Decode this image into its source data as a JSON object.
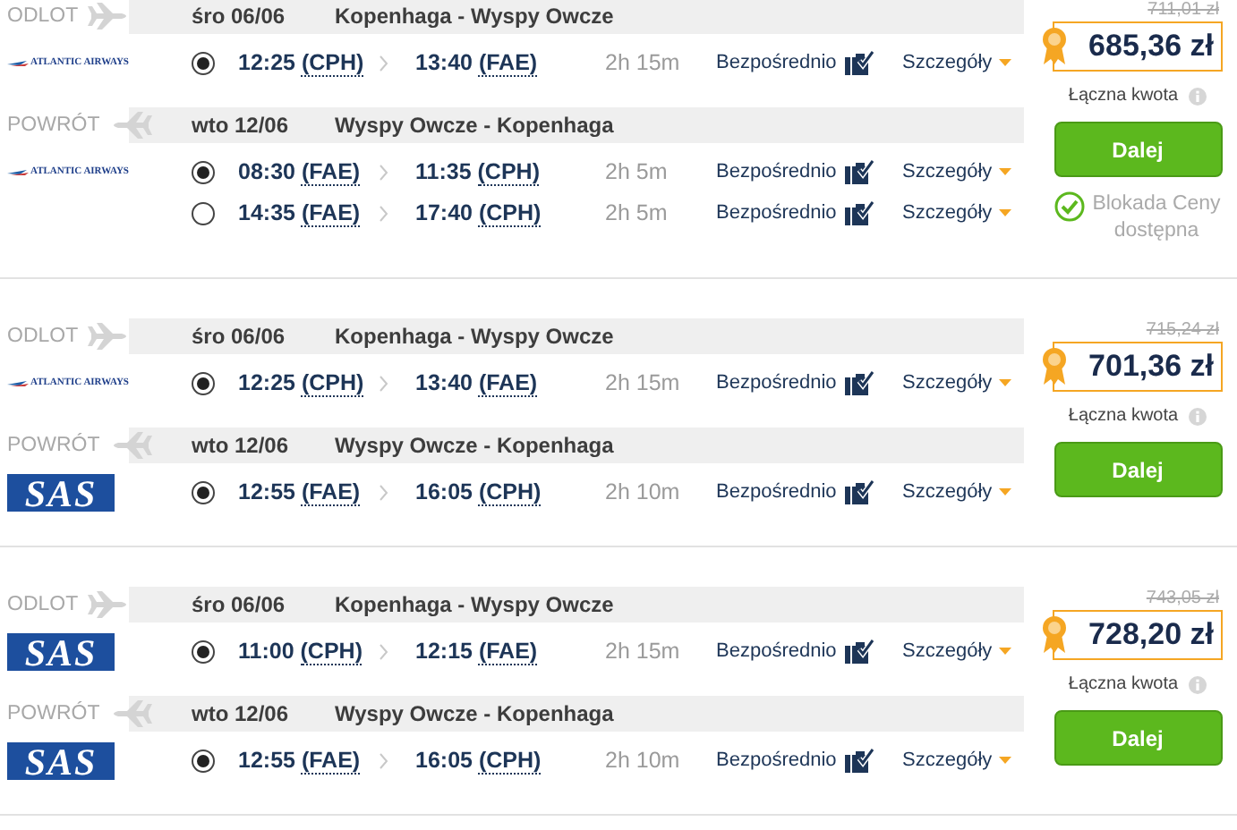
{
  "results": [
    {
      "legs": [
        {
          "kind": "outbound",
          "label": "ODLOT",
          "date": "śro 06/06",
          "route": "Kopenhaga - Wyspy Owcze",
          "airline": {
            "kind": "atlantic",
            "logo_text": "ATLANTIC AIRWAYS"
          },
          "flights": [
            {
              "selected": true,
              "departure_time": "12:25",
              "departure_airport": "(CPH)",
              "arrival_time": "13:40",
              "arrival_airport": "(FAE)",
              "duration": "2h 15m",
              "stops": "Bezpośrednio",
              "details": "Szczegóły"
            }
          ]
        },
        {
          "kind": "return",
          "label": "POWRÓT",
          "date": "wto 12/06",
          "route": "Wyspy Owcze - Kopenhaga",
          "airline": {
            "kind": "atlantic",
            "logo_text": "ATLANTIC AIRWAYS"
          },
          "flights": [
            {
              "selected": true,
              "departure_time": "08:30",
              "departure_airport": "(FAE)",
              "arrival_time": "11:35",
              "arrival_airport": "(CPH)",
              "duration": "2h 5m",
              "stops": "Bezpośrednio",
              "details": "Szczegóły"
            },
            {
              "selected": false,
              "departure_time": "14:35",
              "departure_airport": "(FAE)",
              "arrival_time": "17:40",
              "arrival_airport": "(CPH)",
              "duration": "2h 5m",
              "stops": "Bezpośrednio",
              "details": "Szczegóły"
            }
          ]
        }
      ],
      "old_price": "711,01 zł",
      "price": "685,36 zł",
      "total_label": "Łączna kwota",
      "button": "Dalej",
      "price_lock": "Blokada Ceny dostępna"
    },
    {
      "legs": [
        {
          "kind": "outbound",
          "label": "ODLOT",
          "date": "śro 06/06",
          "route": "Kopenhaga - Wyspy Owcze",
          "airline": {
            "kind": "atlantic",
            "logo_text": "ATLANTIC AIRWAYS"
          },
          "flights": [
            {
              "selected": true,
              "departure_time": "12:25",
              "departure_airport": "(CPH)",
              "arrival_time": "13:40",
              "arrival_airport": "(FAE)",
              "duration": "2h 15m",
              "stops": "Bezpośrednio",
              "details": "Szczegóły"
            }
          ]
        },
        {
          "kind": "return",
          "label": "POWRÓT",
          "date": "wto 12/06",
          "route": "Wyspy Owcze - Kopenhaga",
          "airline": {
            "kind": "sas",
            "logo_text": "SAS"
          },
          "flights": [
            {
              "selected": true,
              "departure_time": "12:55",
              "departure_airport": "(FAE)",
              "arrival_time": "16:05",
              "arrival_airport": "(CPH)",
              "duration": "2h 10m",
              "stops": "Bezpośrednio",
              "details": "Szczegóły"
            }
          ]
        }
      ],
      "old_price": "715,24 zł",
      "price": "701,36 zł",
      "total_label": "Łączna kwota",
      "button": "Dalej"
    },
    {
      "legs": [
        {
          "kind": "outbound",
          "label": "ODLOT",
          "date": "śro 06/06",
          "route": "Kopenhaga - Wyspy Owcze",
          "airline": {
            "kind": "sas",
            "logo_text": "SAS"
          },
          "flights": [
            {
              "selected": true,
              "departure_time": "11:00",
              "departure_airport": "(CPH)",
              "arrival_time": "12:15",
              "arrival_airport": "(FAE)",
              "duration": "2h 15m",
              "stops": "Bezpośrednio",
              "details": "Szczegóły"
            }
          ]
        },
        {
          "kind": "return",
          "label": "POWRÓT",
          "date": "wto 12/06",
          "route": "Wyspy Owcze - Kopenhaga",
          "airline": {
            "kind": "sas",
            "logo_text": "SAS"
          },
          "flights": [
            {
              "selected": true,
              "departure_time": "12:55",
              "departure_airport": "(FAE)",
              "arrival_time": "16:05",
              "arrival_airport": "(CPH)",
              "duration": "2h 10m",
              "stops": "Bezpośrednio",
              "details": "Szczegóły"
            }
          ]
        }
      ],
      "old_price": "743,05 zł",
      "price": "728,20 zł",
      "total_label": "Łączna kwota",
      "button": "Dalej"
    }
  ]
}
